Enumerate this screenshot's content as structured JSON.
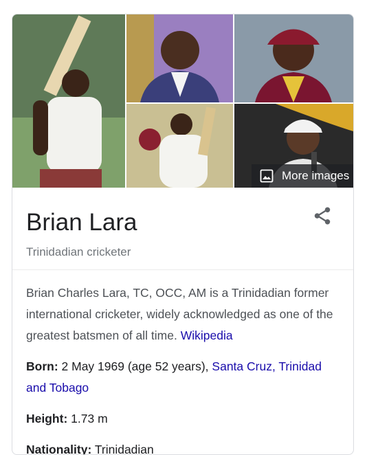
{
  "gallery": {
    "more_images_label": "More images"
  },
  "entity": {
    "name": "Brian Lara",
    "subtitle": "Trinidadian cricketer"
  },
  "description": {
    "text": "Brian Charles Lara, TC, OCC, AM is a Trinidadian former international cricketer, widely acknowledged as one of the greatest batsmen of all time.",
    "source_link": "Wikipedia"
  },
  "facts": {
    "born": {
      "label": "Born:",
      "value": "2 May 1969 (age 52 years),",
      "link": "Santa Cruz, Trinidad and Tobago"
    },
    "height": {
      "label": "Height:",
      "value": "1.73 m"
    },
    "nationality": {
      "label": "Nationality:",
      "value": "Trinidadian"
    }
  },
  "colors": {
    "link": "#1a0dab",
    "title": "#202124",
    "muted": "#70757a",
    "maroon": "#7a1530"
  }
}
